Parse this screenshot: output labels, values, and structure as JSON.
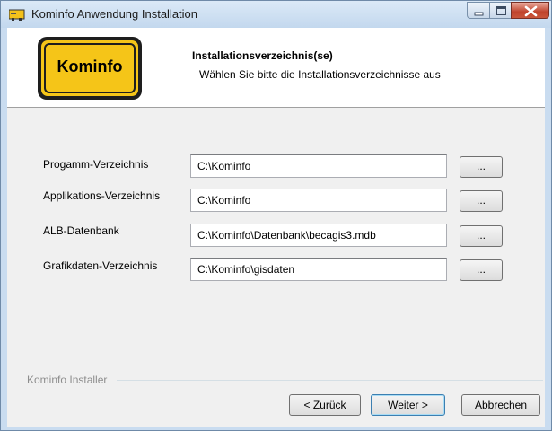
{
  "window": {
    "title": "Kominfo Anwendung Installation"
  },
  "header": {
    "logo_text": "Kominfo",
    "title": "Installationsverzeichnis(se)",
    "subtitle": "Wählen Sie bitte die Installationsverzeichnisse aus"
  },
  "rows": [
    {
      "label": "Progamm-Verzeichnis",
      "value": "C:\\Kominfo",
      "browse_label": "..."
    },
    {
      "label": "Applikations-Verzeichnis",
      "value": "C:\\Kominfo",
      "browse_label": "..."
    },
    {
      "label": "ALB-Datenbank",
      "value": "C:\\Kominfo\\Datenbank\\becagis3.mdb",
      "browse_label": "..."
    },
    {
      "label": "Grafikdaten-Verzeichnis",
      "value": "C:\\Kominfo\\gisdaten",
      "browse_label": "..."
    }
  ],
  "footer": {
    "group_label": "Kominfo Installer",
    "back_label": "< Zurück",
    "next_label": "Weiter >",
    "cancel_label": "Abbrechen"
  },
  "colors": {
    "logo_sign_yellow": "#f5c518",
    "titlebar": "#c9dcf0",
    "close_button": "#c0432c"
  },
  "icons": [
    "installer-app-icon",
    "minimize-icon",
    "maximize-icon",
    "close-icon"
  ]
}
